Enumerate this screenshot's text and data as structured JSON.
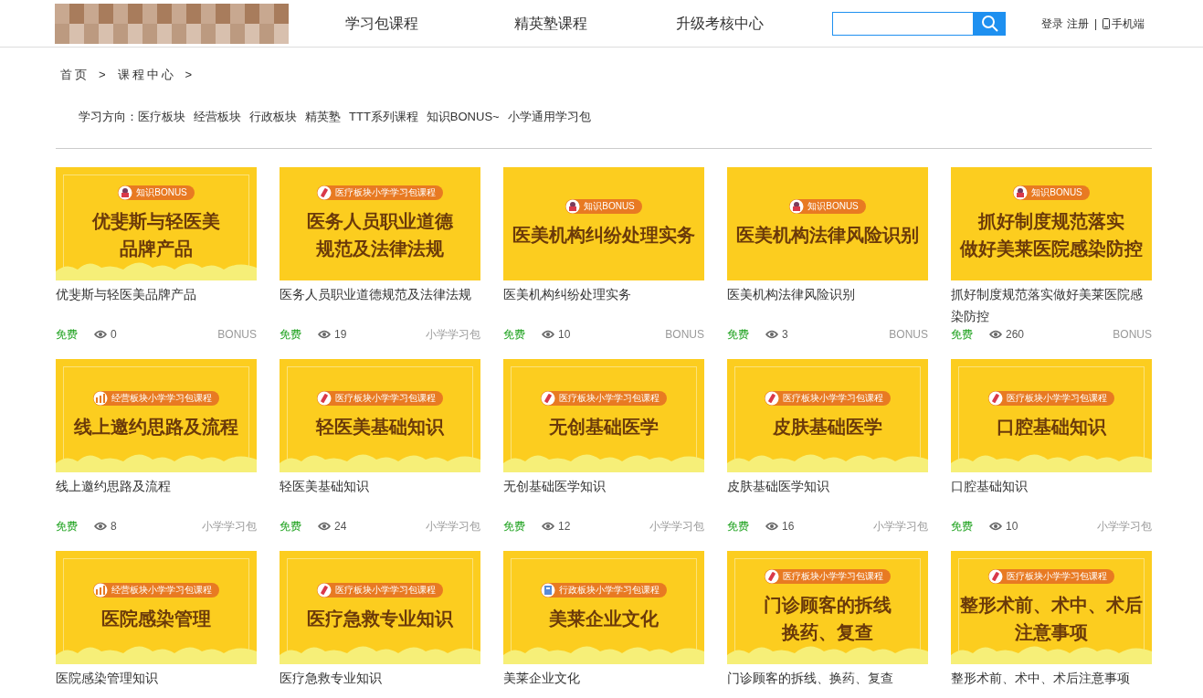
{
  "header": {
    "nav": [
      "学习包课程",
      "精英塾课程",
      "升级考核中心"
    ],
    "links": [
      "登录",
      "注册",
      "|",
      "手机端"
    ]
  },
  "breadcrumb": [
    "首页",
    ">",
    "课程中心",
    ">"
  ],
  "filter": {
    "label": "学习方向：",
    "options": [
      "医疗板块",
      "经营板块",
      "行政板块",
      "精英塾",
      "TTT系列课程",
      "知识BONUS~",
      "小学通用学习包"
    ]
  },
  "courses": [
    {
      "thumb": {
        "kind": "bonus",
        "badge": "知识BONUS",
        "lines": [
          "优斐斯与轻医美",
          "品牌产品"
        ],
        "decorated": true
      },
      "title": "优斐斯与轻医美品牌产品",
      "price": "免费",
      "views": "0",
      "tag": "BONUS"
    },
    {
      "thumb": {
        "kind": "medical",
        "badge": "医疗板块小学学习包课程",
        "lines": [
          "医务人员职业道德",
          "规范及法律法规"
        ],
        "decorated": false
      },
      "title": "医务人员职业道德规范及法律法规",
      "price": "免费",
      "views": "19",
      "tag": "小学学习包"
    },
    {
      "thumb": {
        "kind": "bonus",
        "badge": "知识BONUS",
        "lines": [
          "医美机构纠纷处理实务"
        ],
        "decorated": false
      },
      "title": "医美机构纠纷处理实务",
      "price": "免费",
      "views": "10",
      "tag": "BONUS"
    },
    {
      "thumb": {
        "kind": "bonus",
        "badge": "知识BONUS",
        "lines": [
          "医美机构法律风险识别"
        ],
        "decorated": false
      },
      "title": "医美机构法律风险识别",
      "price": "免费",
      "views": "3",
      "tag": "BONUS"
    },
    {
      "thumb": {
        "kind": "bonus",
        "badge": "知识BONUS",
        "lines": [
          "抓好制度规范落实",
          "做好美莱医院感染防控"
        ],
        "decorated": false
      },
      "title": "抓好制度规范落实做好美莱医院感染防控",
      "price": "免费",
      "views": "260",
      "tag": "BONUS"
    },
    {
      "thumb": {
        "kind": "business",
        "badge": "经营板块小学学习包课程",
        "lines": [
          "线上邀约思路及流程"
        ],
        "decorated": true
      },
      "title": "线上邀约思路及流程",
      "price": "免费",
      "views": "8",
      "tag": "小学学习包"
    },
    {
      "thumb": {
        "kind": "medical",
        "badge": "医疗板块小学学习包课程",
        "lines": [
          "轻医美基础知识"
        ],
        "decorated": true
      },
      "title": "轻医美基础知识",
      "price": "免费",
      "views": "24",
      "tag": "小学学习包"
    },
    {
      "thumb": {
        "kind": "medical",
        "badge": "医疗板块小学学习包课程",
        "lines": [
          "无创基础医学"
        ],
        "decorated": true
      },
      "title": "无创基础医学知识",
      "price": "免费",
      "views": "12",
      "tag": "小学学习包"
    },
    {
      "thumb": {
        "kind": "medical",
        "badge": "医疗板块小学学习包课程",
        "lines": [
          "皮肤基础医学"
        ],
        "decorated": true
      },
      "title": "皮肤基础医学知识",
      "price": "免费",
      "views": "16",
      "tag": "小学学习包"
    },
    {
      "thumb": {
        "kind": "medical",
        "badge": "医疗板块小学学习包课程",
        "lines": [
          "口腔基础知识"
        ],
        "decorated": true
      },
      "title": "口腔基础知识",
      "price": "免费",
      "views": "10",
      "tag": "小学学习包"
    },
    {
      "thumb": {
        "kind": "business",
        "badge": "经营板块小学学习包课程",
        "lines": [
          "医院感染管理"
        ],
        "decorated": true
      },
      "title": "医院感染管理知识"
    },
    {
      "thumb": {
        "kind": "medical",
        "badge": "医疗板块小学学习包课程",
        "lines": [
          "医疗急救专业知识"
        ],
        "decorated": true
      },
      "title": "医疗急救专业知识"
    },
    {
      "thumb": {
        "kind": "admin",
        "badge": "行政板块小学学习包课程",
        "lines": [
          "美莱企业文化"
        ],
        "decorated": true
      },
      "title": "美莱企业文化"
    },
    {
      "thumb": {
        "kind": "medical",
        "badge": "医疗板块小学学习包课程",
        "lines": [
          "门诊顾客的拆线",
          "换药、复查"
        ],
        "decorated": true
      },
      "title": "门诊顾客的拆线、换药、复查"
    },
    {
      "thumb": {
        "kind": "medical",
        "badge": "医疗板块小学学习包课程",
        "lines": [
          "整形术前、术中、术后",
          "注意事项"
        ],
        "decorated": true
      },
      "title": "整形术前、术中、术后注意事项"
    }
  ]
}
